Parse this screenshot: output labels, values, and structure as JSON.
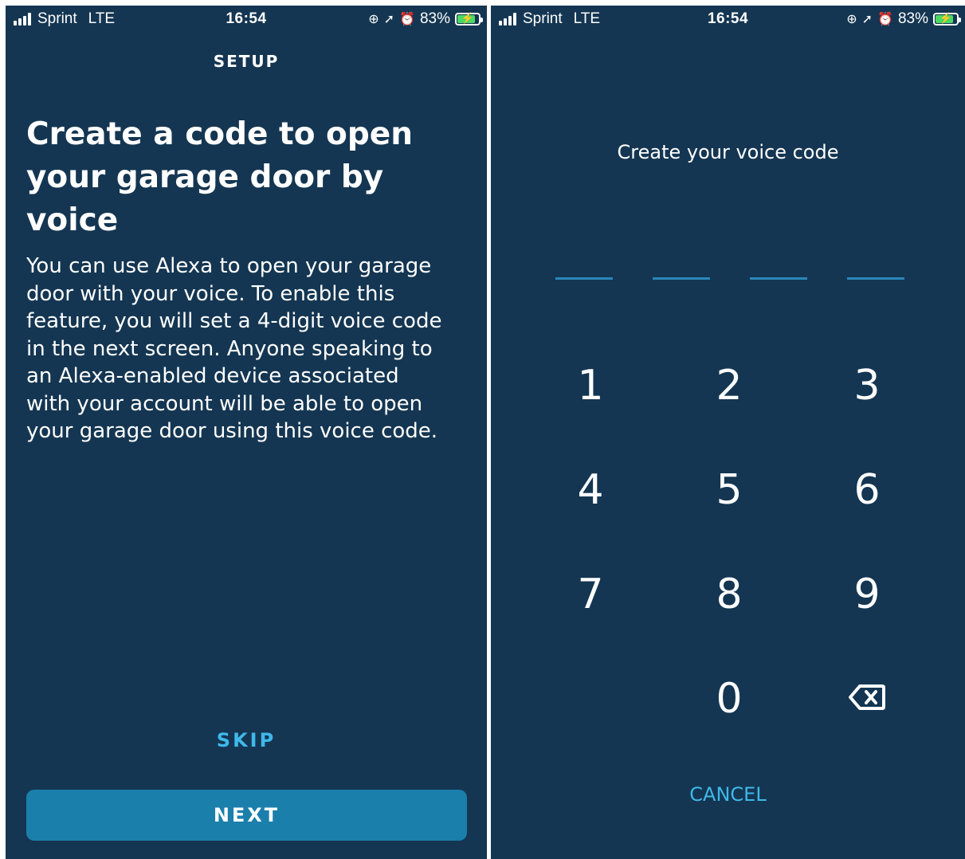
{
  "status_bar": {
    "carrier": "Sprint",
    "network": "LTE",
    "time": "16:54",
    "battery": "83%",
    "icons": [
      "signal-icon",
      "orientation-lock-icon",
      "location-icon",
      "alarm-icon",
      "battery-charging-icon"
    ]
  },
  "setup_screen": {
    "nav_title": "SETUP",
    "headline": "Create a code to open your garage door by voice",
    "body": "You can use Alexa to open your garage door with your voice. To enable this feature, you will set a 4-digit voice code in the next screen. Anyone speaking to an Alexa-enabled device associated with your account will be able to open your garage door using this voice code.",
    "skip_label": "SKIP",
    "next_label": "NEXT"
  },
  "voice_code_screen": {
    "prompt": "Create your voice code",
    "slots": 4,
    "keys": [
      "1",
      "2",
      "3",
      "4",
      "5",
      "6",
      "7",
      "8",
      "9",
      "0"
    ],
    "backspace_icon": "backspace-icon",
    "cancel_label": "CANCEL"
  },
  "colors": {
    "background": "#143652",
    "accent": "#3fb8ea",
    "button": "#1b7fac",
    "slot": "#2b86b9"
  }
}
